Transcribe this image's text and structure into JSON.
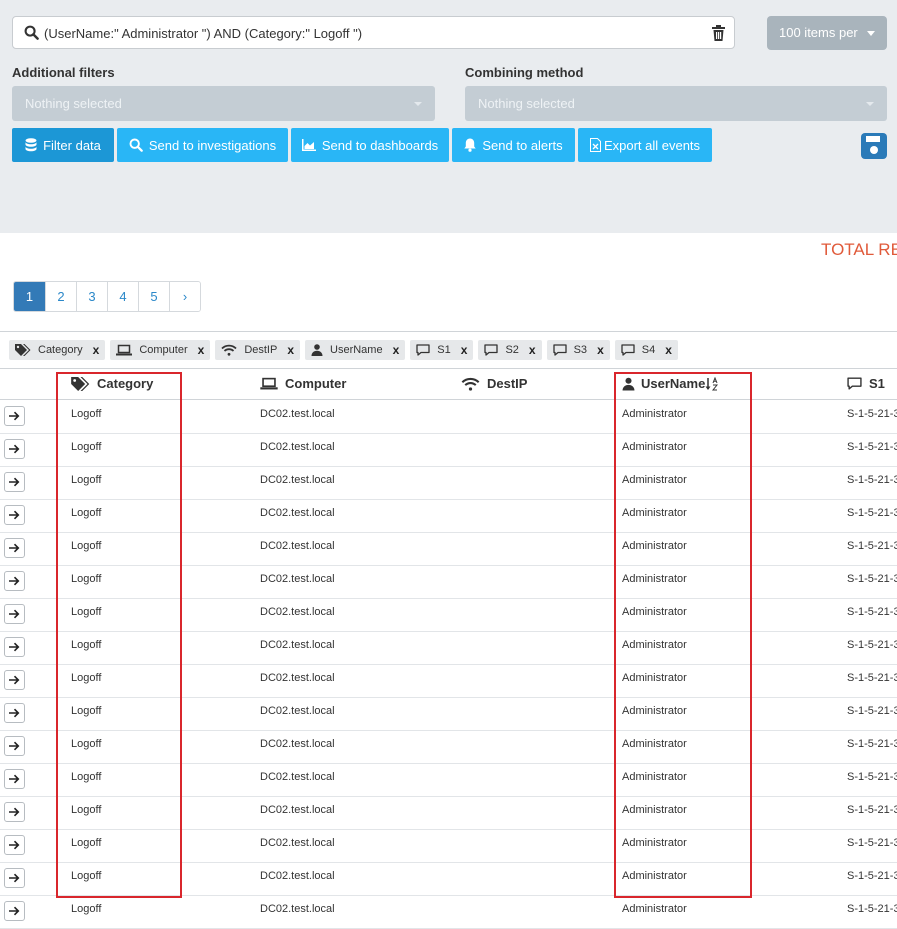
{
  "search": {
    "query": "(UserName:\" Administrator \") AND (Category:\" Logoff \")",
    "items_per_page_label": "100 items per"
  },
  "filters": {
    "additional_label": "Additional filters",
    "additional_placeholder": "Nothing selected",
    "combining_label": "Combining method",
    "combining_placeholder": "Nothing selected"
  },
  "actions": {
    "filter_data": "Filter data",
    "send_investigations": "Send to investigations",
    "send_dashboards": "Send to dashboards",
    "send_alerts": "Send to alerts",
    "export_events": "Export all events"
  },
  "total_label": "TOTAL RE",
  "pagination": {
    "pages": [
      "1",
      "2",
      "3",
      "4",
      "5"
    ],
    "next": "›",
    "active_page": "1"
  },
  "column_chips": [
    {
      "label": "Category",
      "icon": "tags-icon"
    },
    {
      "label": "Computer",
      "icon": "laptop-icon"
    },
    {
      "label": "DestIP",
      "icon": "wifi-icon"
    },
    {
      "label": "UserName",
      "icon": "user-icon"
    },
    {
      "label": "S1",
      "icon": "comment-icon"
    },
    {
      "label": "S2",
      "icon": "comment-icon"
    },
    {
      "label": "S3",
      "icon": "comment-icon"
    },
    {
      "label": "S4",
      "icon": "comment-icon"
    }
  ],
  "chip_remove": "x",
  "table": {
    "headers": {
      "category": "Category",
      "computer": "Computer",
      "destip": "DestIP",
      "username": "UserName",
      "s1": "S1"
    },
    "rows": [
      {
        "category": "Logoff",
        "computer": "DC02.test.local",
        "destip": "",
        "username": "Administrator",
        "s1": "S-1-5-21-3"
      },
      {
        "category": "Logoff",
        "computer": "DC02.test.local",
        "destip": "",
        "username": "Administrator",
        "s1": "S-1-5-21-3"
      },
      {
        "category": "Logoff",
        "computer": "DC02.test.local",
        "destip": "",
        "username": "Administrator",
        "s1": "S-1-5-21-3"
      },
      {
        "category": "Logoff",
        "computer": "DC02.test.local",
        "destip": "",
        "username": "Administrator",
        "s1": "S-1-5-21-3"
      },
      {
        "category": "Logoff",
        "computer": "DC02.test.local",
        "destip": "",
        "username": "Administrator",
        "s1": "S-1-5-21-3"
      },
      {
        "category": "Logoff",
        "computer": "DC02.test.local",
        "destip": "",
        "username": "Administrator",
        "s1": "S-1-5-21-3"
      },
      {
        "category": "Logoff",
        "computer": "DC02.test.local",
        "destip": "",
        "username": "Administrator",
        "s1": "S-1-5-21-3"
      },
      {
        "category": "Logoff",
        "computer": "DC02.test.local",
        "destip": "",
        "username": "Administrator",
        "s1": "S-1-5-21-3"
      },
      {
        "category": "Logoff",
        "computer": "DC02.test.local",
        "destip": "",
        "username": "Administrator",
        "s1": "S-1-5-21-3"
      },
      {
        "category": "Logoff",
        "computer": "DC02.test.local",
        "destip": "",
        "username": "Administrator",
        "s1": "S-1-5-21-3"
      },
      {
        "category": "Logoff",
        "computer": "DC02.test.local",
        "destip": "",
        "username": "Administrator",
        "s1": "S-1-5-21-3"
      },
      {
        "category": "Logoff",
        "computer": "DC02.test.local",
        "destip": "",
        "username": "Administrator",
        "s1": "S-1-5-21-3"
      },
      {
        "category": "Logoff",
        "computer": "DC02.test.local",
        "destip": "",
        "username": "Administrator",
        "s1": "S-1-5-21-3"
      },
      {
        "category": "Logoff",
        "computer": "DC02.test.local",
        "destip": "",
        "username": "Administrator",
        "s1": "S-1-5-21-3"
      },
      {
        "category": "Logoff",
        "computer": "DC02.test.local",
        "destip": "",
        "username": "Administrator",
        "s1": "S-1-5-21-3"
      },
      {
        "category": "Logoff",
        "computer": "DC02.test.local",
        "destip": "",
        "username": "Administrator",
        "s1": "S-1-5-21-3"
      }
    ]
  },
  "colors": {
    "accent": "#29b6f6",
    "page_active": "#337ab7",
    "total": "#e05a3a",
    "highlight": "#d9262c"
  }
}
